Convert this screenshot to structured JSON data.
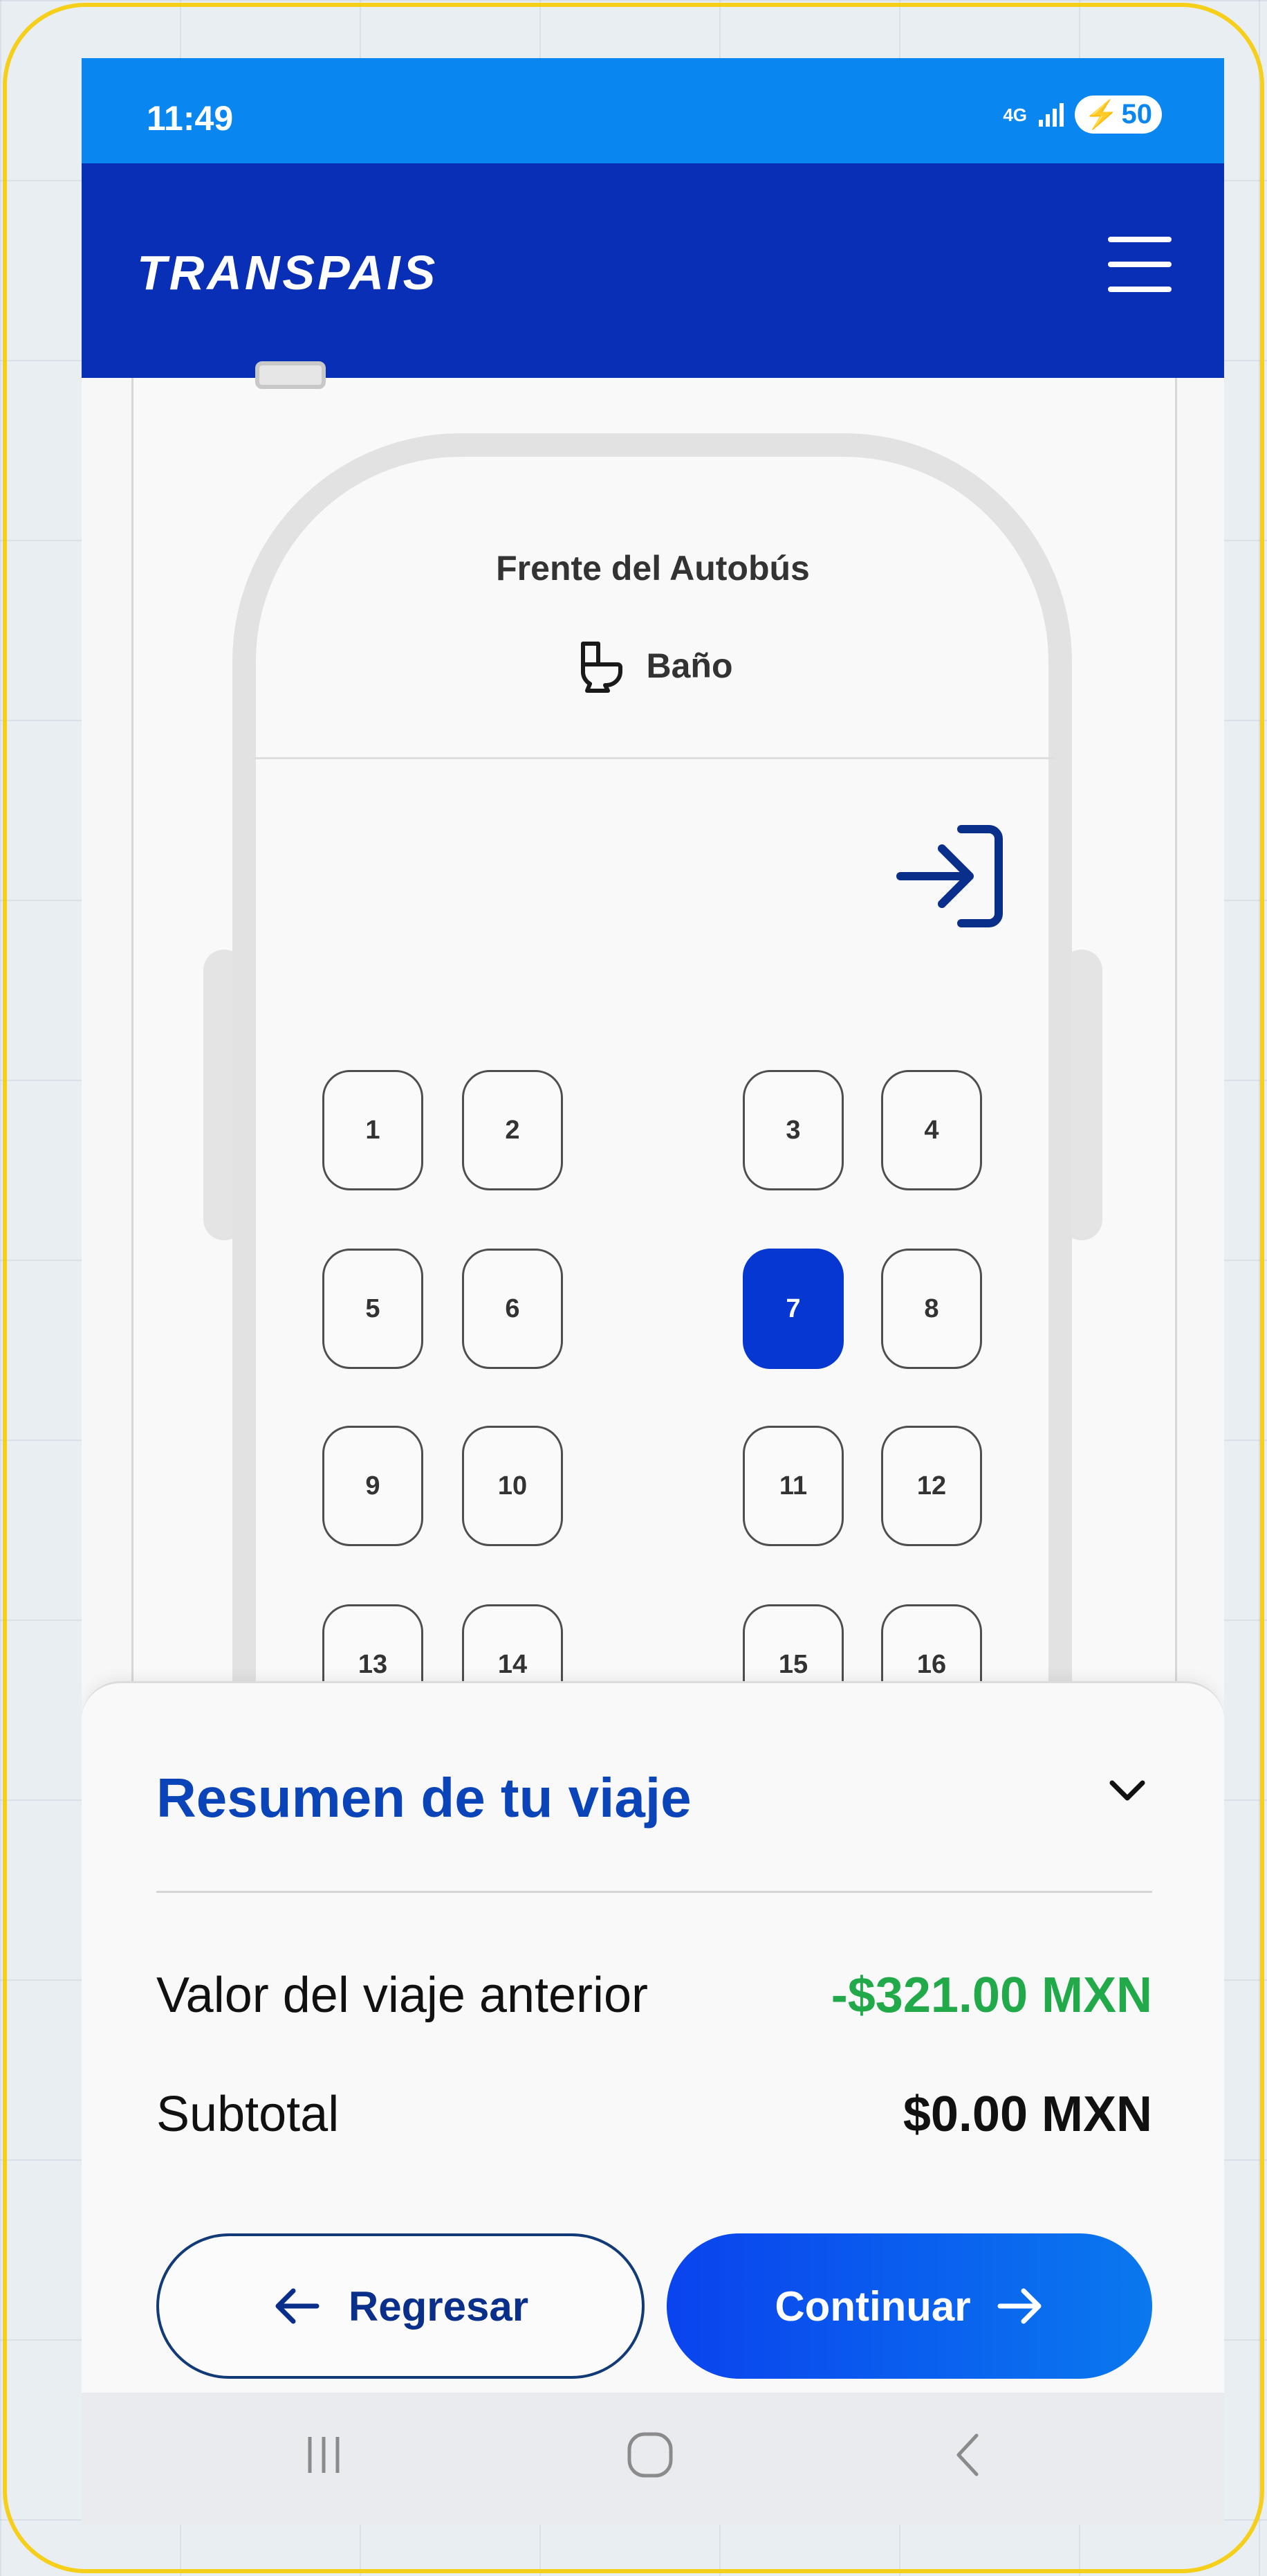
{
  "status_bar": {
    "time": "11:49",
    "network": "4G",
    "battery": "50",
    "battery_icon": "charging-bolt"
  },
  "header": {
    "logo_text": "TRANSPAIS",
    "menu_icon": "hamburger-menu"
  },
  "bus": {
    "front_label": "Frente del Autobús",
    "bathroom_label": "Baño",
    "bathroom_icon": "toilet-icon",
    "entrance_icon": "door-entrance-icon",
    "seats": [
      {
        "number": "1",
        "selected": false
      },
      {
        "number": "2",
        "selected": false
      },
      {
        "number": "3",
        "selected": false
      },
      {
        "number": "4",
        "selected": false
      },
      {
        "number": "5",
        "selected": false
      },
      {
        "number": "6",
        "selected": false
      },
      {
        "number": "7",
        "selected": true
      },
      {
        "number": "8",
        "selected": false
      },
      {
        "number": "9",
        "selected": false
      },
      {
        "number": "10",
        "selected": false
      },
      {
        "number": "11",
        "selected": false
      },
      {
        "number": "12",
        "selected": false
      },
      {
        "number": "13",
        "selected": false
      },
      {
        "number": "14",
        "selected": false
      },
      {
        "number": "15",
        "selected": false
      },
      {
        "number": "16",
        "selected": false
      }
    ]
  },
  "summary": {
    "title": "Resumen de tu viaje",
    "prev_trip_label": "Valor del viaje anterior",
    "prev_trip_value": "-$321.00 MXN",
    "subtotal_label": "Subtotal",
    "subtotal_value": "$0.00 MXN",
    "back_label": "Regresar",
    "continue_label": "Continuar"
  },
  "colors": {
    "brand_blue": "#0a2fb7",
    "status_blue": "#0a86f1",
    "selected_seat": "#0737d1",
    "discount_green": "#21a94a",
    "frame_yellow": "#f5cf1a"
  }
}
